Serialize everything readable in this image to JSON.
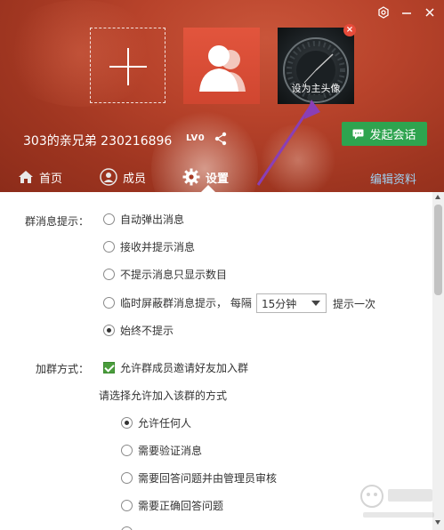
{
  "window": {
    "icons": [
      "settings-icon",
      "minimize-icon",
      "close-icon"
    ]
  },
  "header": {
    "avatar_overlay_label": "设为主头像",
    "group_name": "303的亲兄弟 230216896",
    "level": "LV0",
    "start_chat_label": "发起会话",
    "accent_green": "#2ea44f"
  },
  "tabs": [
    {
      "label": "首页",
      "icon": "home-icon"
    },
    {
      "label": "成员",
      "icon": "member-icon"
    },
    {
      "label": "设置",
      "icon": "gear-icon",
      "active": true
    }
  ],
  "edit_link_label": "编辑资料",
  "message_section": {
    "label": "群消息提示：",
    "options": [
      {
        "label": "自动弹出消息",
        "checked": false
      },
      {
        "label": "接收并提示消息",
        "checked": false
      },
      {
        "label": "不提示消息只显示数目",
        "checked": false
      },
      {
        "label": "临时屏蔽群消息提示， 每隔",
        "checked": false
      },
      {
        "label": "始终不提示",
        "checked": true
      }
    ],
    "interval_value": "15分钟",
    "interval_suffix": "提示一次"
  },
  "join_section": {
    "label": "加群方式：",
    "allow_invite_label": "允许群成员邀请好友加入群",
    "allow_invite_checked": true,
    "method_prompt": "请选择允许加入该群的方式",
    "options": [
      {
        "label": "允许任何人",
        "checked": true
      },
      {
        "label": "需要验证消息",
        "checked": false
      },
      {
        "label": "需要回答问题并由管理员审核",
        "checked": false
      },
      {
        "label": "需要正确回答问题",
        "checked": false
      }
    ]
  }
}
